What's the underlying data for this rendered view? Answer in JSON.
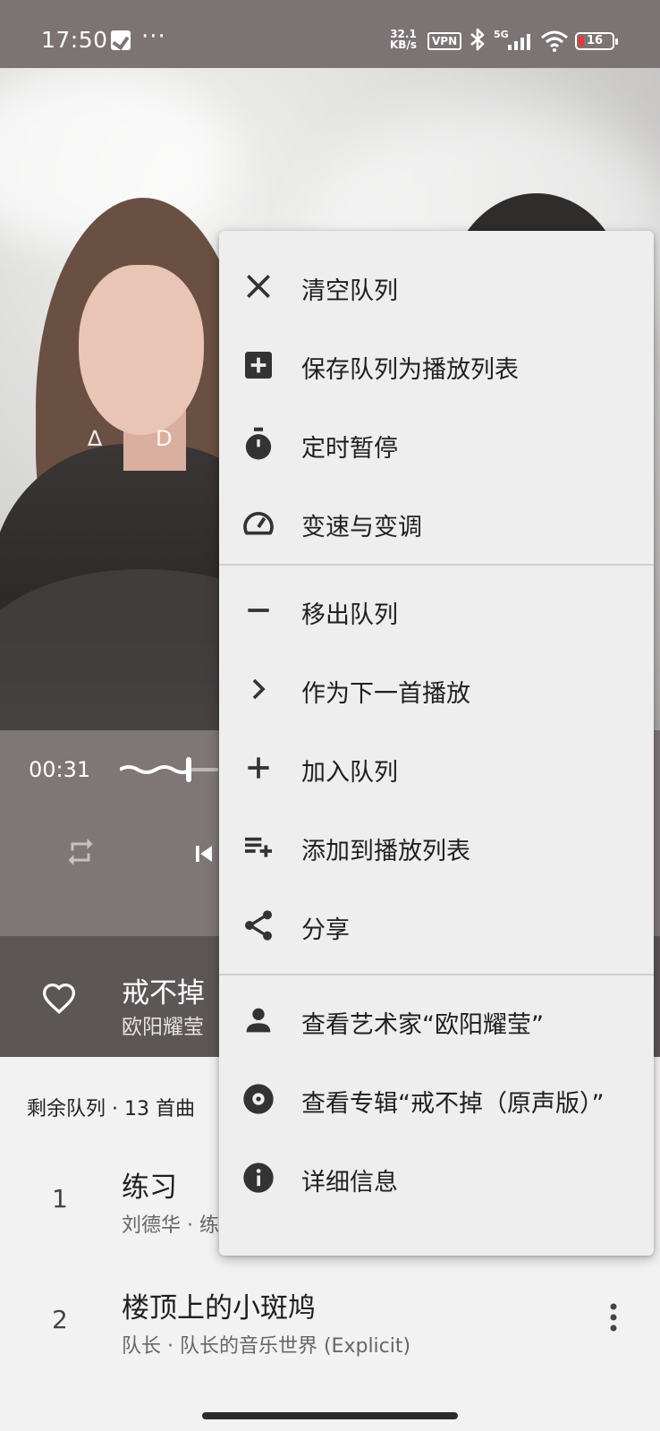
{
  "status_bar": {
    "time": "17:50",
    "dots": "···",
    "speed_value": "32.1",
    "speed_unit": "KB/s",
    "vpn": "VPN",
    "network": "5G",
    "battery": "16"
  },
  "album_art": {
    "glyph_left": "∆",
    "glyph_right": "D"
  },
  "player": {
    "position": "00:31"
  },
  "now_playing": {
    "title": "戒不掉",
    "artist": "欧阳耀莹"
  },
  "queue": {
    "header": "剩余队列 · 13 首曲",
    "items": [
      {
        "num": "1",
        "title": "练习",
        "subtitle": "刘德华 · 练"
      },
      {
        "num": "2",
        "title": "楼顶上的小斑鸠",
        "subtitle": "队长 · 队长的音乐世界 (Explicit)"
      }
    ]
  },
  "menu": {
    "items": [
      {
        "label": "清空队列",
        "icon": "close-icon"
      },
      {
        "label": "保存队列为播放列表",
        "icon": "add-box-icon"
      },
      {
        "label": "定时暂停",
        "icon": "timer-icon"
      },
      {
        "label": "变速与变调",
        "icon": "speed-icon"
      },
      {
        "label": "移出队列",
        "icon": "minus-icon"
      },
      {
        "label": "作为下一首播放",
        "icon": "chevron-right-icon"
      },
      {
        "label": "加入队列",
        "icon": "plus-icon"
      },
      {
        "label": "添加到播放列表",
        "icon": "playlist-add-icon"
      },
      {
        "label": "分享",
        "icon": "share-icon"
      },
      {
        "label": "查看艺术家“欧阳耀莹”",
        "icon": "person-icon"
      },
      {
        "label": "查看专辑“戒不掉（原声版）”",
        "icon": "album-icon"
      },
      {
        "label": "详细信息",
        "icon": "info-icon"
      }
    ]
  },
  "colors": {
    "status_bar": "#7c7375",
    "player_bg": "#7e7677",
    "now_playing_bg": "#5c5657",
    "menu_bg": "#eeeeee",
    "icon": "#333333"
  }
}
